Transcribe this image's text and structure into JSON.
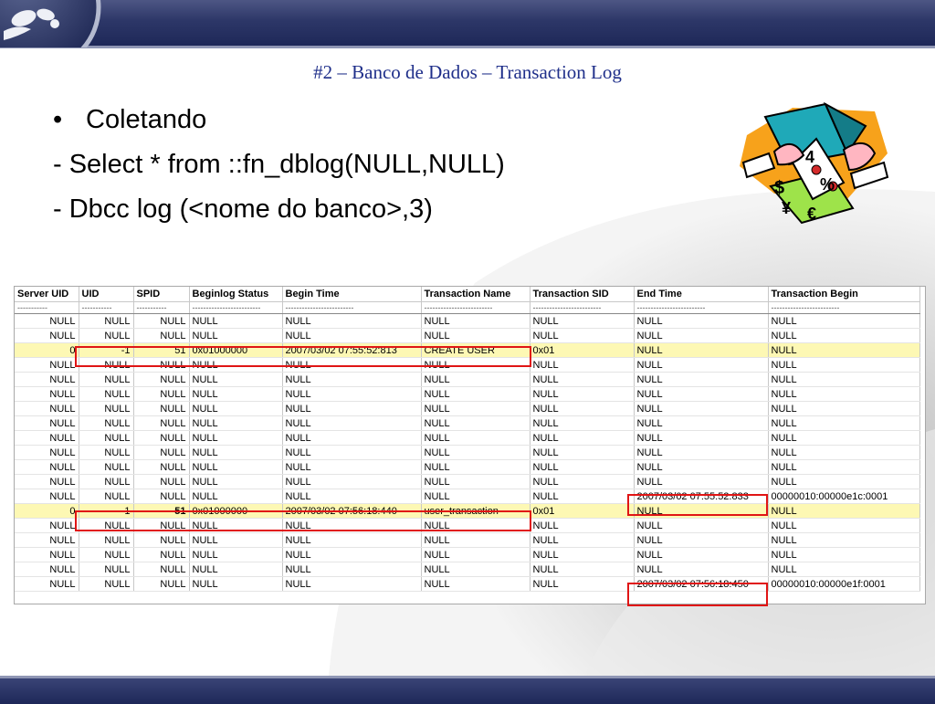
{
  "slide": {
    "title": "#2 – Banco de Dados – Transaction Log"
  },
  "bullets": [
    {
      "marker": "•",
      "text": "Coletando"
    },
    {
      "marker": "",
      "text": "- Select * from ::fn_dblog(NULL,NULL)"
    },
    {
      "marker": "",
      "text": "- Dbcc log (<nome do banco>,3)"
    }
  ],
  "table": {
    "columns": [
      "Server UID",
      "UID",
      "SPID",
      "Beginlog Status",
      "Begin Time",
      "Transaction Name",
      "Transaction SID",
      "End Time",
      "Transaction Begin"
    ],
    "dashes": [
      "-----------",
      "-----------",
      "-----------",
      "-------------------------",
      "-------------------------",
      "-------------------------",
      "-------------------------",
      "-------------------------",
      "-------------------------"
    ],
    "rows": [
      [
        "NULL",
        "NULL",
        "NULL",
        "NULL",
        "NULL",
        "NULL",
        "NULL",
        "NULL",
        "NULL"
      ],
      [
        "NULL",
        "NULL",
        "NULL",
        "NULL",
        "NULL",
        "NULL",
        "NULL",
        "NULL",
        "NULL"
      ],
      [
        "0",
        "-1",
        "51",
        "0x01000000",
        "2007/03/02 07:55:52:813",
        "CREATE USER",
        "0x01",
        "NULL",
        "NULL"
      ],
      [
        "NULL",
        "NULL",
        "NULL",
        "NULL",
        "NULL",
        "NULL",
        "NULL",
        "NULL",
        "NULL"
      ],
      [
        "NULL",
        "NULL",
        "NULL",
        "NULL",
        "NULL",
        "NULL",
        "NULL",
        "NULL",
        "NULL"
      ],
      [
        "NULL",
        "NULL",
        "NULL",
        "NULL",
        "NULL",
        "NULL",
        "NULL",
        "NULL",
        "NULL"
      ],
      [
        "NULL",
        "NULL",
        "NULL",
        "NULL",
        "NULL",
        "NULL",
        "NULL",
        "NULL",
        "NULL"
      ],
      [
        "NULL",
        "NULL",
        "NULL",
        "NULL",
        "NULL",
        "NULL",
        "NULL",
        "NULL",
        "NULL"
      ],
      [
        "NULL",
        "NULL",
        "NULL",
        "NULL",
        "NULL",
        "NULL",
        "NULL",
        "NULL",
        "NULL"
      ],
      [
        "NULL",
        "NULL",
        "NULL",
        "NULL",
        "NULL",
        "NULL",
        "NULL",
        "NULL",
        "NULL"
      ],
      [
        "NULL",
        "NULL",
        "NULL",
        "NULL",
        "NULL",
        "NULL",
        "NULL",
        "NULL",
        "NULL"
      ],
      [
        "NULL",
        "NULL",
        "NULL",
        "NULL",
        "NULL",
        "NULL",
        "NULL",
        "NULL",
        "NULL"
      ],
      [
        "NULL",
        "NULL",
        "NULL",
        "NULL",
        "NULL",
        "NULL",
        "NULL",
        "2007/03/02 07:55:52:833",
        "00000010:00000e1c:0001"
      ],
      [
        "0",
        "-1",
        "51",
        "0x01000000",
        "2007/03/02 07:56:18:440",
        "user_transaction",
        "0x01",
        "NULL",
        "NULL"
      ],
      [
        "NULL",
        "NULL",
        "NULL",
        "NULL",
        "NULL",
        "NULL",
        "NULL",
        "NULL",
        "NULL"
      ],
      [
        "NULL",
        "NULL",
        "NULL",
        "NULL",
        "NULL",
        "NULL",
        "NULL",
        "NULL",
        "NULL"
      ],
      [
        "NULL",
        "NULL",
        "NULL",
        "NULL",
        "NULL",
        "NULL",
        "NULL",
        "NULL",
        "NULL"
      ],
      [
        "NULL",
        "NULL",
        "NULL",
        "NULL",
        "NULL",
        "NULL",
        "NULL",
        "NULL",
        "NULL"
      ],
      [
        "NULL",
        "NULL",
        "NULL",
        "NULL",
        "NULL",
        "NULL",
        "NULL",
        "2007/03/02 07:56:18:450",
        "00000010:00000e1f:0001"
      ]
    ],
    "highlight_color": "#fdf8b4",
    "annotation_color": "#e01515"
  },
  "clipart": {
    "icon": "money-exchange-icon",
    "symbols": [
      "$",
      "4",
      "%",
      "¥",
      "€"
    ]
  },
  "logo": {
    "icon": "owasp-wasp-logo-icon"
  },
  "colors": {
    "header_bar": "#2d3768",
    "title_text": "#1f2f8a"
  }
}
